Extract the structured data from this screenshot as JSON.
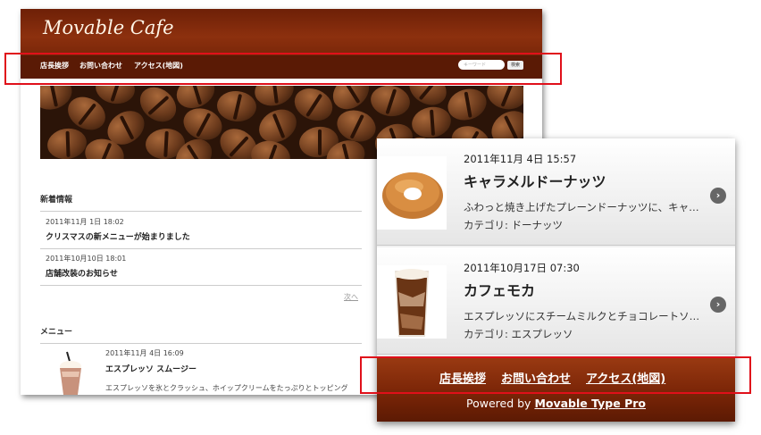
{
  "desktop": {
    "site_title": "Movable Cafe",
    "nav": [
      "店長挨拶",
      "お問い合わせ",
      "アクセス(地図)"
    ],
    "search": {
      "placeholder": "キーワード",
      "button_label": "検索"
    },
    "news": {
      "heading": "新着情報",
      "entries": [
        {
          "date": "2011年11月 1日 18:02",
          "title": "クリスマスの新メニューが始まりました"
        },
        {
          "date": "2011年10月10日 18:01",
          "title": "店舗改装のお知らせ"
        }
      ],
      "more_label": "次へ"
    },
    "menu": {
      "heading": "メニュー",
      "entries": [
        {
          "date": "2011年11月 4日 16:09",
          "title": "エスプレッソ スムージー",
          "excerpt": "エスプレッソを氷とクラッシュ、ホイップクリームをたっぷりとトッピング"
        }
      ]
    }
  },
  "mobile": {
    "items": [
      {
        "date": "2011年11月 4日 15:57",
        "title": "キャラメルドーナッツ",
        "excerpt": "ふわっと焼き上げたプレーンドーナッツに、キャラメル…",
        "category": "カテゴリ: ドーナッツ",
        "icon": "donut-image"
      },
      {
        "date": "2011年10月17日 07:30",
        "title": "カフェモカ",
        "excerpt": "エスプレッソにスチームミルクとチョコレートソース…",
        "category": "カテゴリ: エスプレッソ",
        "icon": "iced-coffee-image"
      }
    ],
    "footer": {
      "links": [
        "店長挨拶",
        "お問い合わせ",
        "アクセス(地図)"
      ],
      "powered_prefix": "Powered by ",
      "powered_link": "Movable Type Pro"
    }
  },
  "colors": {
    "brand_brown": "#7a2709",
    "nav_dark": "#5a1a05",
    "highlight_red": "#e0101a"
  }
}
